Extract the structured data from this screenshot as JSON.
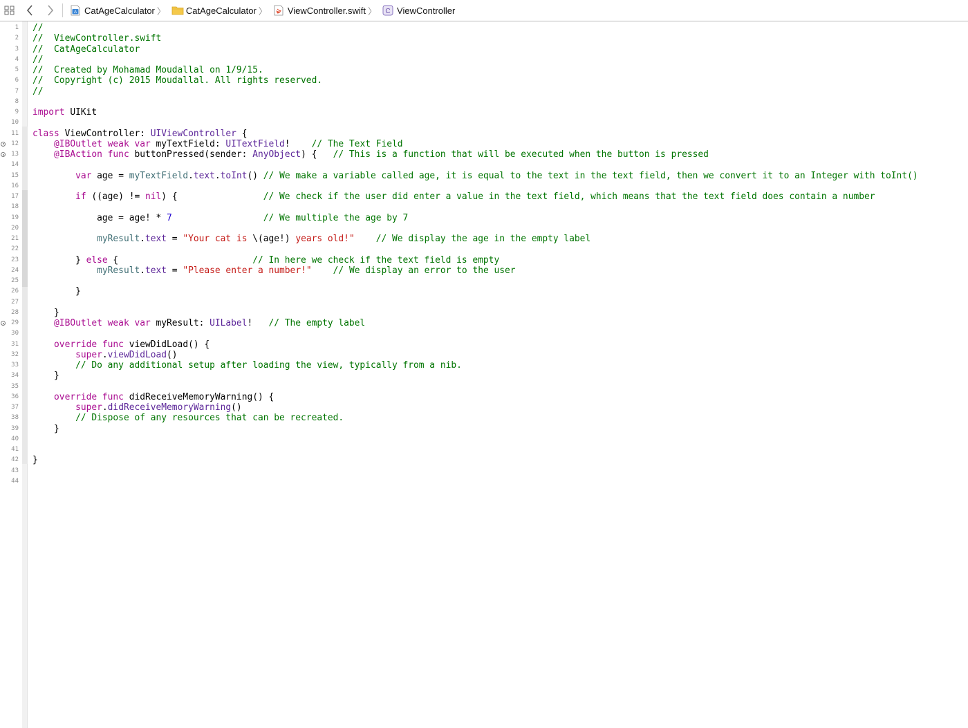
{
  "jumpbar": {
    "grid_icon": "related-items-grid-icon",
    "back_icon": "chevron-left-icon",
    "forward_icon": "chevron-right-icon",
    "crumbs": [
      {
        "label": "CatAgeCalculator",
        "icon": "project-file-icon"
      },
      {
        "label": "CatAgeCalculator",
        "icon": "folder-icon"
      },
      {
        "label": "ViewController.swift",
        "icon": "swift-file-icon"
      },
      {
        "label": "ViewController",
        "icon": "class-c-icon"
      }
    ],
    "chevron": "〉"
  },
  "colors": {
    "comment": "#007400",
    "keyword": "#aa0d91",
    "type": "#5c2699",
    "project_symbol": "#3f6e74",
    "string": "#c41a16",
    "number": "#1c00cf",
    "folder": "#f5c94a"
  },
  "gutter": {
    "line_numbers": [
      "1",
      "2",
      "3",
      "4",
      "5",
      "6",
      "7",
      "8",
      "9",
      "10",
      "11",
      "12",
      "13",
      "14",
      "15",
      "16",
      "17",
      "18",
      "19",
      "20",
      "21",
      "22",
      "23",
      "24",
      "25",
      "26",
      "27",
      "28",
      "29",
      "30",
      "31",
      "32",
      "33",
      "34",
      "35",
      "36",
      "37",
      "38",
      "39",
      "40",
      "41",
      "42",
      "43",
      "44"
    ],
    "connected_outlet_lines": [
      "12",
      "13",
      "29"
    ]
  },
  "code": [
    [
      {
        "t": "//",
        "c": "comment"
      }
    ],
    [
      {
        "t": "//  ViewController.swift",
        "c": "comment"
      }
    ],
    [
      {
        "t": "//  CatAgeCalculator",
        "c": "comment"
      }
    ],
    [
      {
        "t": "//",
        "c": "comment"
      }
    ],
    [
      {
        "t": "//  Created by Mohamad Moudallal on 1/9/15.",
        "c": "comment"
      }
    ],
    [
      {
        "t": "//  Copyright (c) 2015 Moudallal. All rights reserved.",
        "c": "comment"
      }
    ],
    [
      {
        "t": "//",
        "c": "comment"
      }
    ],
    [],
    [
      {
        "t": "import",
        "c": "kw"
      },
      {
        "t": " UIKit",
        "c": "plain"
      }
    ],
    [],
    [
      {
        "t": "class",
        "c": "kw"
      },
      {
        "t": " ViewController: ",
        "c": "plain"
      },
      {
        "t": "UIViewController",
        "c": "type"
      },
      {
        "t": " {",
        "c": "plain"
      }
    ],
    [
      {
        "t": "    ",
        "c": "plain"
      },
      {
        "t": "@IBOutlet weak var",
        "c": "kw"
      },
      {
        "t": " myTextField: ",
        "c": "plain"
      },
      {
        "t": "UITextField",
        "c": "type"
      },
      {
        "t": "!    ",
        "c": "plain"
      },
      {
        "t": "// The Text Field",
        "c": "comment"
      }
    ],
    [
      {
        "t": "    ",
        "c": "plain"
      },
      {
        "t": "@IBAction func",
        "c": "kw"
      },
      {
        "t": " buttonPressed(sender: ",
        "c": "plain"
      },
      {
        "t": "AnyObject",
        "c": "type"
      },
      {
        "t": ") {   ",
        "c": "plain"
      },
      {
        "t": "// This is a function that will be executed when the button is pressed",
        "c": "comment"
      }
    ],
    [],
    [
      {
        "t": "        ",
        "c": "plain"
      },
      {
        "t": "var",
        "c": "kw"
      },
      {
        "t": " age = ",
        "c": "plain"
      },
      {
        "t": "myTextField",
        "c": "proj"
      },
      {
        "t": ".",
        "c": "plain"
      },
      {
        "t": "text",
        "c": "type"
      },
      {
        "t": ".",
        "c": "plain"
      },
      {
        "t": "toInt",
        "c": "type"
      },
      {
        "t": "() ",
        "c": "plain"
      },
      {
        "t": "// We make a variable called age, it is equal to the text in the text field, then we convert it to an Integer with toInt()",
        "c": "comment"
      }
    ],
    [],
    [
      {
        "t": "        ",
        "c": "plain"
      },
      {
        "t": "if",
        "c": "kw"
      },
      {
        "t": " ((age) != ",
        "c": "plain"
      },
      {
        "t": "nil",
        "c": "kw"
      },
      {
        "t": ") {                ",
        "c": "plain"
      },
      {
        "t": "// We check if the user did enter a value in the text field, which means that the text field does contain a number",
        "c": "comment"
      }
    ],
    [],
    [
      {
        "t": "            age = age! * ",
        "c": "plain"
      },
      {
        "t": "7",
        "c": "num"
      },
      {
        "t": "                 ",
        "c": "plain"
      },
      {
        "t": "// We multiple the age by 7",
        "c": "comment"
      }
    ],
    [],
    [
      {
        "t": "            ",
        "c": "plain"
      },
      {
        "t": "myResult",
        "c": "proj"
      },
      {
        "t": ".",
        "c": "plain"
      },
      {
        "t": "text",
        "c": "type"
      },
      {
        "t": " = ",
        "c": "plain"
      },
      {
        "t": "\"Your cat is ",
        "c": "str"
      },
      {
        "t": "\\(age!)",
        "c": "plain"
      },
      {
        "t": " years old!\"",
        "c": "str"
      },
      {
        "t": "    ",
        "c": "plain"
      },
      {
        "t": "// We display the age in the empty label",
        "c": "comment"
      }
    ],
    [],
    [
      {
        "t": "        } ",
        "c": "plain"
      },
      {
        "t": "else",
        "c": "kw"
      },
      {
        "t": " {                         ",
        "c": "plain"
      },
      {
        "t": "// In here we check if the text field is empty",
        "c": "comment"
      }
    ],
    [
      {
        "t": "            ",
        "c": "plain"
      },
      {
        "t": "myResult",
        "c": "proj"
      },
      {
        "t": ".",
        "c": "plain"
      },
      {
        "t": "text",
        "c": "type"
      },
      {
        "t": " = ",
        "c": "plain"
      },
      {
        "t": "\"Please enter a number!\"",
        "c": "str"
      },
      {
        "t": "    ",
        "c": "plain"
      },
      {
        "t": "// We display an error to the user",
        "c": "comment"
      }
    ],
    [],
    [
      {
        "t": "        }",
        "c": "plain"
      }
    ],
    [],
    [
      {
        "t": "    }",
        "c": "plain"
      }
    ],
    [
      {
        "t": "    ",
        "c": "plain"
      },
      {
        "t": "@IBOutlet weak var",
        "c": "kw"
      },
      {
        "t": " myResult: ",
        "c": "plain"
      },
      {
        "t": "UILabel",
        "c": "type"
      },
      {
        "t": "!   ",
        "c": "plain"
      },
      {
        "t": "// The empty label",
        "c": "comment"
      }
    ],
    [],
    [
      {
        "t": "    ",
        "c": "plain"
      },
      {
        "t": "override func",
        "c": "kw"
      },
      {
        "t": " viewDidLoad() {",
        "c": "plain"
      }
    ],
    [
      {
        "t": "        ",
        "c": "plain"
      },
      {
        "t": "super",
        "c": "kw"
      },
      {
        "t": ".",
        "c": "plain"
      },
      {
        "t": "viewDidLoad",
        "c": "type"
      },
      {
        "t": "()",
        "c": "plain"
      }
    ],
    [
      {
        "t": "        ",
        "c": "plain"
      },
      {
        "t": "// Do any additional setup after loading the view, typically from a nib.",
        "c": "comment"
      }
    ],
    [
      {
        "t": "    }",
        "c": "plain"
      }
    ],
    [],
    [
      {
        "t": "    ",
        "c": "plain"
      },
      {
        "t": "override func",
        "c": "kw"
      },
      {
        "t": " didReceiveMemoryWarning() {",
        "c": "plain"
      }
    ],
    [
      {
        "t": "        ",
        "c": "plain"
      },
      {
        "t": "super",
        "c": "kw"
      },
      {
        "t": ".",
        "c": "plain"
      },
      {
        "t": "didReceiveMemoryWarning",
        "c": "type"
      },
      {
        "t": "()",
        "c": "plain"
      }
    ],
    [
      {
        "t": "        ",
        "c": "plain"
      },
      {
        "t": "// Dispose of any resources that can be recreated.",
        "c": "comment"
      }
    ],
    [
      {
        "t": "    }",
        "c": "plain"
      }
    ],
    [],
    [],
    [
      {
        "t": "}",
        "c": "plain"
      }
    ],
    [],
    []
  ]
}
